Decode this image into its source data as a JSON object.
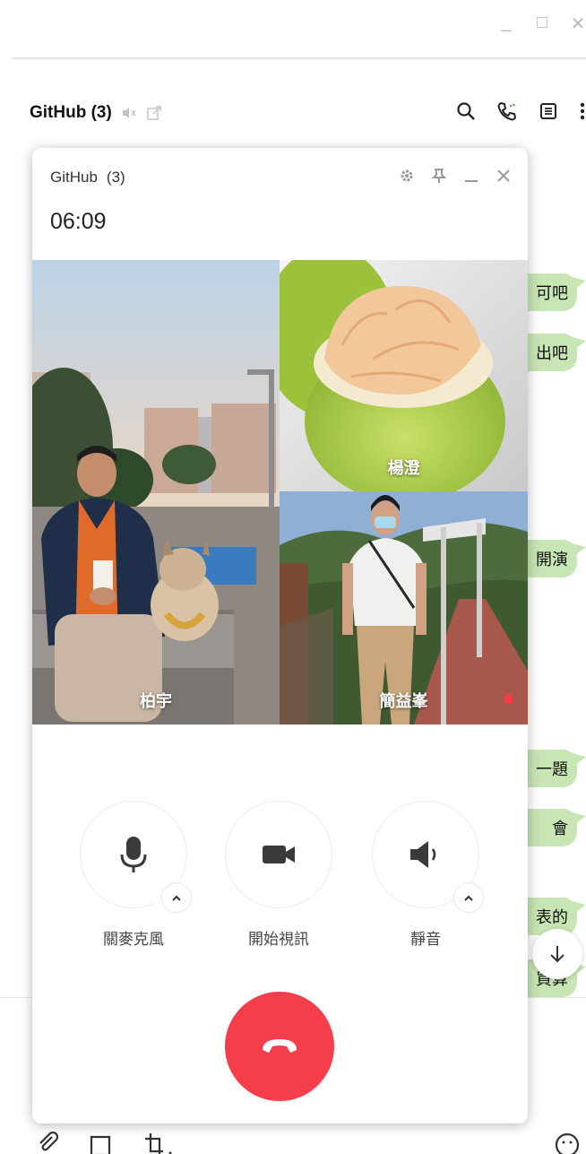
{
  "window": {
    "controls": [
      "minimize",
      "maximize",
      "close"
    ]
  },
  "chat": {
    "title": "GitHub (3)",
    "header_icons": [
      "search-icon",
      "call-icon",
      "notes-icon",
      "more-icon"
    ]
  },
  "bubbles": [
    "可吧",
    "出吧",
    "開演",
    "一題",
    "會",
    "表的",
    "買算"
  ],
  "call": {
    "title": "GitHub",
    "count": "(3)",
    "timer": "06:09",
    "participants": [
      {
        "name": "柏宇"
      },
      {
        "name": "楊澄"
      },
      {
        "name": "簡益峯"
      }
    ],
    "actions": {
      "mic_label": "關麥克風",
      "video_label": "開始視訊",
      "mute_label": "靜音"
    }
  },
  "colors": {
    "accent_bubble": "#c8e6b3",
    "hangup": "#f63d4c",
    "speaking": "#ff3b4b"
  }
}
